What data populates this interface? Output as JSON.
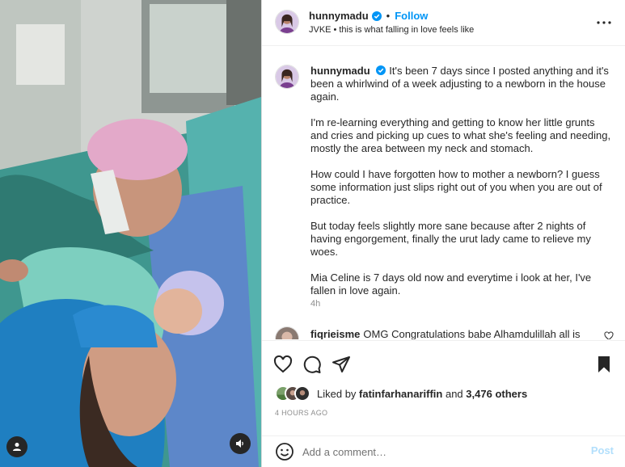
{
  "colors": {
    "accent": "#0095f6",
    "verified": "#0095f6",
    "muted": "#8e8e8e",
    "post_disabled": "#b2dffc"
  },
  "header": {
    "username": "hunnymadu",
    "separator": "•",
    "follow_label": "Follow",
    "audio_artist": "JVKE",
    "audio_separator": "•",
    "audio_title": "this is what falling in love feels like",
    "more_icon": "more-horizontal-icon"
  },
  "caption": {
    "username": "hunnymadu",
    "paragraphs": [
      "It's been 7 days since I posted anything and it's been a whirlwind of a week adjusting to a newborn in the house again.",
      "I'm re-learning everything and getting to know her little grunts and cries and picking up cues to what she's feeling and needing, mostly the area between my neck and stomach.",
      "How could I have forgotten how to mother a newborn? I guess some information just slips right out of you when you are out of practice.",
      "But today feels slightly more sane because after 2 nights of having engorgement, finally the urut lady came to relieve my woes.",
      "Mia Celine is 7 days old now and everytime i look at her, I've fallen in love again."
    ],
    "time": "4h"
  },
  "comment": {
    "username": "fiqrieisme",
    "text": "OMG Congratulations babe Alhamdulillah all is"
  },
  "actions": {
    "like_icon": "heart-icon",
    "comment_icon": "comment-bubble-icon",
    "share_icon": "paper-plane-icon",
    "save_icon": "bookmark-icon"
  },
  "likes": {
    "prefix": "Liked by",
    "user": "fatinfarhanariffin",
    "and": "and",
    "count_text": "3,476 others"
  },
  "post_time": "4 HOURS AGO",
  "add_comment": {
    "placeholder": "Add a comment…",
    "post_label": "Post"
  },
  "media": {
    "user_tag_icon": "user-tag-icon",
    "mute_icon": "speaker-icon"
  }
}
